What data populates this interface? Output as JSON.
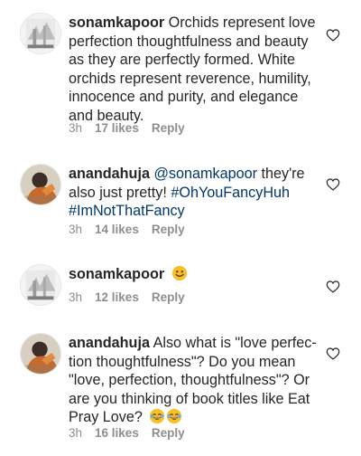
{
  "comments": [
    {
      "username": "sonamkapoor",
      "text": "Orchids represent love perfection thoughtfulness and beauty as they are perfectly formed. White orchids represent reverence, humility, innocence and purity, and elegance and beauty.",
      "time": "3h",
      "likes": "17 likes",
      "reply": "Reply",
      "icons": {
        "avatar": "avatar-sonamkapoor",
        "like": "heart-outline-icon"
      }
    },
    {
      "username": "anandahuja",
      "mention": "@sonamkapoor",
      "text": " they're also just pretty! ",
      "hashtag1": "#OhYouFancyHuh",
      "hashtag2": "#ImNotThatFancy",
      "time": "3h",
      "likes": "14 likes",
      "reply": "Reply",
      "icons": {
        "avatar": "avatar-anandahuja",
        "like": "heart-outline-icon"
      }
    },
    {
      "username": "sonamkapoor",
      "emoji": "slightly-smiling-face-emoji",
      "time": "3h",
      "likes": "12 likes",
      "reply": "Reply",
      "icons": {
        "avatar": "avatar-sonamkapoor",
        "like": "heart-outline-icon"
      }
    },
    {
      "username": "anandahuja",
      "text": "Also what is \"love perfec-tion thoughtfulness\"? Do you mean \"love, perfection, thoughtfulness\"? Or are you thinking of book titles like Eat Pray Love?",
      "emoji": "tears-of-joy-emoji",
      "time": "3h",
      "likes": "16 likes",
      "reply": "Reply",
      "icons": {
        "avatar": "avatar-anandahuja",
        "like": "heart-outline-icon"
      }
    }
  ],
  "colors": {
    "text": "#262626",
    "link": "#00376b",
    "meta": "#8e8e8e",
    "emoji": "#f7c02b"
  }
}
